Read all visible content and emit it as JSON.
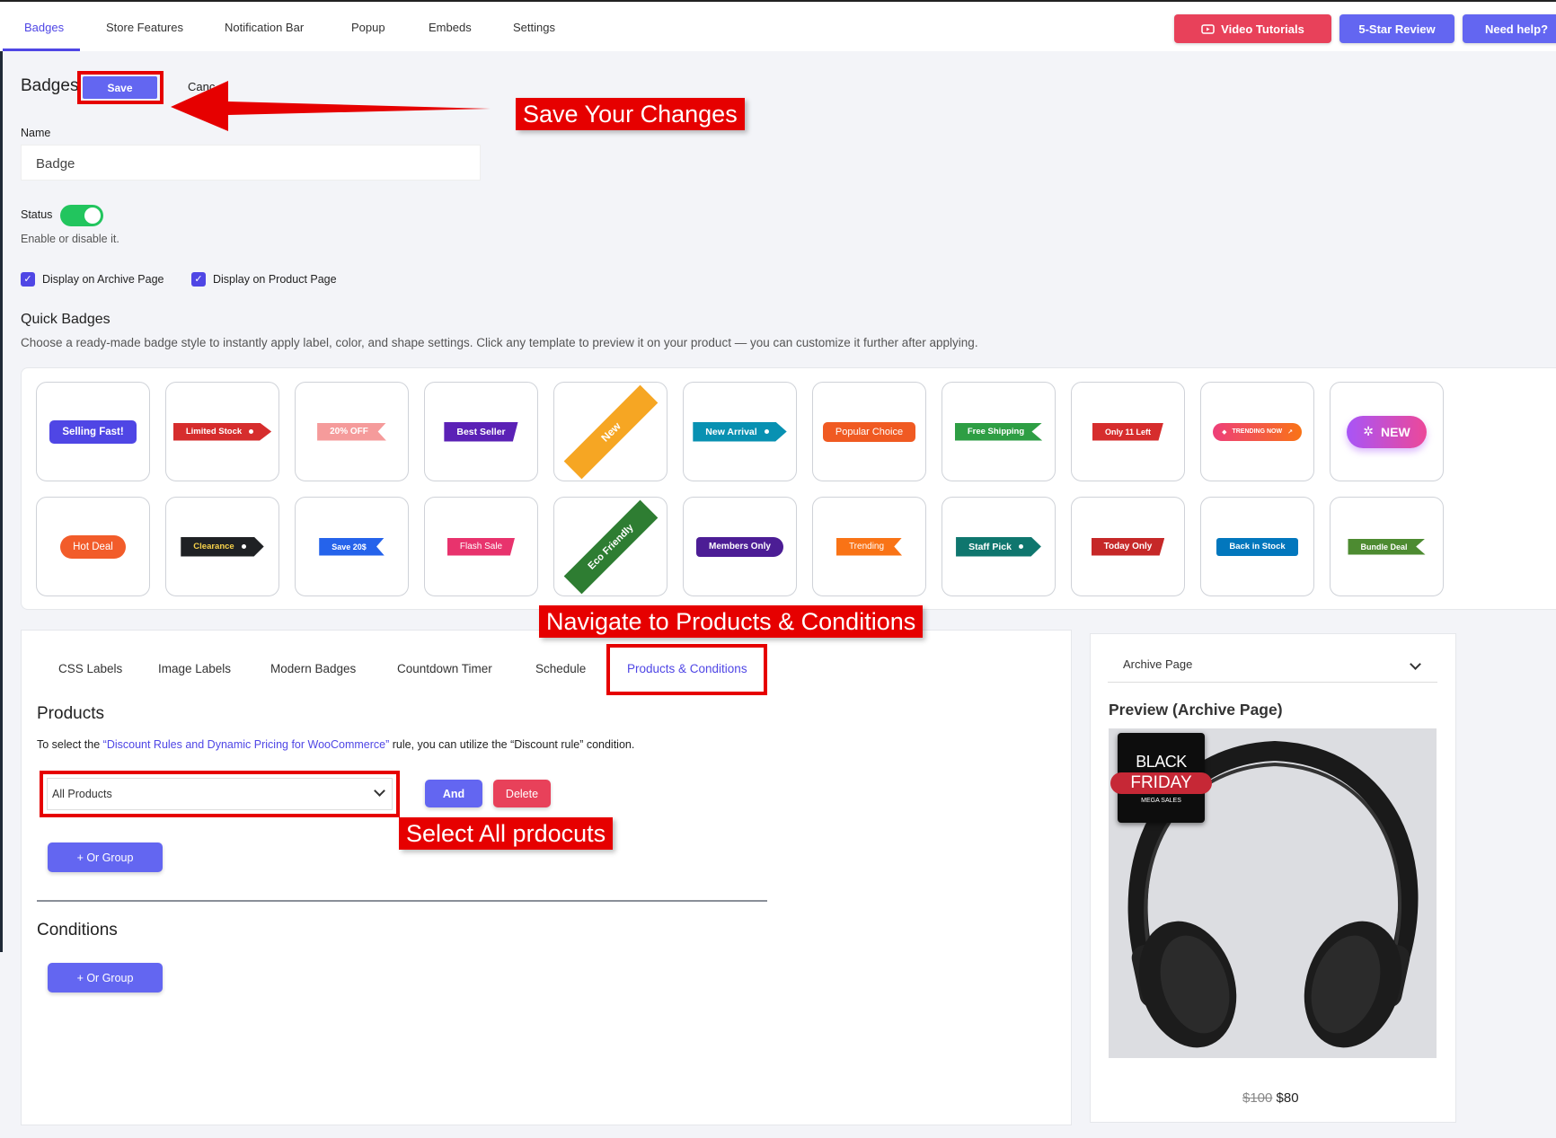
{
  "tabs": [
    "Badges",
    "Store Features",
    "Notification Bar",
    "Popup",
    "Embeds",
    "Settings"
  ],
  "top_buttons": {
    "video": "Video Tutorials",
    "review": "5-Star Review",
    "help": "Need help?"
  },
  "header": {
    "title": "Badges",
    "save": "Save",
    "cancel": "Canc"
  },
  "callouts": {
    "save": "Save Your Changes",
    "navigate": "Navigate to Products & Conditions",
    "select": "Select All prdocuts"
  },
  "form": {
    "name_label": "Name",
    "name_value": "Badge",
    "status_label": "Status",
    "status_help": "Enable or disable it.",
    "status_on": true,
    "archive_label": "Display on Archive Page",
    "product_label": "Display on Product Page"
  },
  "quick_badges": {
    "title": "Quick Badges",
    "description": "Choose a ready-made badge style to instantly apply label, color, and shape settings. Click any template to preview it on your product — you can customize it further after applying.",
    "row1": [
      {
        "label": "Selling Fast!",
        "color": "#4f46e5"
      },
      {
        "label": "Limited Stock",
        "color": "#d62d2d"
      },
      {
        "label": "20% OFF",
        "color": "#f59b9b"
      },
      {
        "label": "Best Seller",
        "color": "#5b21b6"
      },
      {
        "label": "New",
        "color": "#f6a623"
      },
      {
        "label": "New Arrival",
        "color": "#0891b2"
      },
      {
        "label": "Popular Choice",
        "color": "#f05a22"
      },
      {
        "label": "Free Shipping",
        "color": "#2e9e44"
      },
      {
        "label": "Only 11 Left",
        "color": "#d62d2d"
      },
      {
        "label": "TRENDING NOW",
        "color": "#f0506e"
      },
      {
        "label": "NEW",
        "color": "#a855f7"
      }
    ],
    "row2": [
      {
        "label": "Hot Deal",
        "color": "#f25c2a"
      },
      {
        "label": "Clearance",
        "color": "#1f2124"
      },
      {
        "label": "Save 20$",
        "color": "#2563eb"
      },
      {
        "label": "Flash Sale",
        "color": "#e8336d"
      },
      {
        "label": "Eco Friendly",
        "color": "#2e7d32"
      },
      {
        "label": "Members Only",
        "color": "#4c1d95"
      },
      {
        "label": "Trending",
        "color": "#f97316"
      },
      {
        "label": "Staff Pick",
        "color": "#0f766e"
      },
      {
        "label": "Today Only",
        "color": "#c62828"
      },
      {
        "label": "Back in Stock",
        "color": "#0277bd"
      },
      {
        "label": "Bundle Deal",
        "color": "#4d8b31"
      }
    ]
  },
  "subtabs": [
    "CSS Labels",
    "Image Labels",
    "Modern Badges",
    "Countdown Timer",
    "Schedule",
    "Products & Conditions"
  ],
  "products": {
    "title": "Products",
    "info_prefix": "To select the ",
    "info_link": "“Discount Rules and Dynamic Pricing for WooCommerce”",
    "info_suffix": " rule, you can utilize the “Discount rule” condition.",
    "select_value": "All Products",
    "and": "And",
    "delete": "Delete",
    "or_group": "+ Or Group"
  },
  "conditions": {
    "title": "Conditions",
    "or_group": "+ Or Group"
  },
  "preview": {
    "page_select": "Archive Page",
    "title": "Preview (Archive Page)",
    "badge_line1": "BLACK",
    "badge_line2": "FRIDAY",
    "badge_line3": "MEGA SALES",
    "old_price": "$100",
    "new_price": "$80"
  },
  "colors": {
    "accent": "#4f46e5",
    "danger": "#e8415a",
    "callout": "#e60000"
  }
}
